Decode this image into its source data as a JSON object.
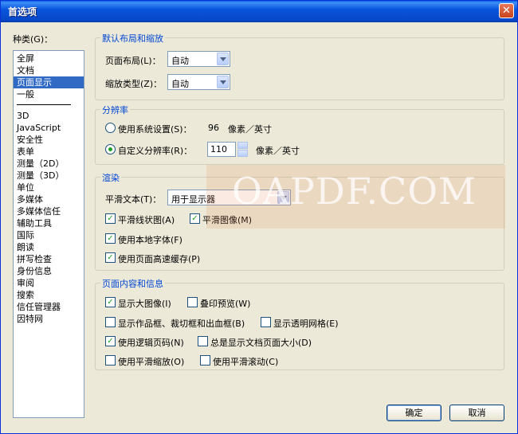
{
  "window": {
    "title": "首选项"
  },
  "category": {
    "label": "种类(G)：",
    "items_top": [
      "全屏",
      "文档",
      "页面显示",
      "一般"
    ],
    "items_bottom": [
      "3D",
      "JavaScript",
      "安全性",
      "表单",
      "测量（2D）",
      "测量（3D）",
      "单位",
      "多媒体",
      "多媒体信任",
      "辅助工具",
      "国际",
      "朗读",
      "拼写检查",
      "身份信息",
      "审阅",
      "搜索",
      "信任管理器",
      "因特网"
    ],
    "selected": "页面显示"
  },
  "layout_group": {
    "title": "默认布局和缩放",
    "page_layout_label": "页面布局(L)：",
    "page_layout_value": "自动",
    "zoom_type_label": "缩放类型(Z)：",
    "zoom_type_value": "自动"
  },
  "resolution_group": {
    "title": "分辨率",
    "system_label": "使用系统设置(S)：",
    "system_value": "96",
    "system_unit": "像素／英寸",
    "custom_label": "自定义分辨率(R)：",
    "custom_value": "110",
    "custom_unit": "像素／英寸",
    "selected": "custom"
  },
  "render_group": {
    "title": "渲染",
    "smooth_text_label": "平滑文本(T)：",
    "smooth_text_value": "用于显示器",
    "smooth_line_art": {
      "label": "平滑线状图(A)",
      "checked": true
    },
    "smooth_images": {
      "label": "平滑图像(M)",
      "checked": true
    },
    "local_fonts": {
      "label": "使用本地字体(F)",
      "checked": true
    },
    "page_cache": {
      "label": "使用页面高速缓存(P)",
      "checked": true
    }
  },
  "content_group": {
    "title": "页面内容和信息",
    "show_large_images": {
      "label": "显示大图像(I)",
      "checked": true
    },
    "overprint_preview": {
      "label": "叠印预览(W)",
      "checked": false
    },
    "show_art_boxes": {
      "label": "显示作品框、裁切框和出血框(B)",
      "checked": false
    },
    "show_transparency_grid": {
      "label": "显示透明网格(E)",
      "checked": false
    },
    "logical_page_numbers": {
      "label": "使用逻辑页码(N)",
      "checked": true
    },
    "always_show_page_size": {
      "label": "总是显示文档页面大小(D)",
      "checked": false
    },
    "smooth_zoom": {
      "label": "使用平滑缩放(O)",
      "checked": false
    },
    "smooth_scroll": {
      "label": "使用平滑滚动(C)",
      "checked": false
    }
  },
  "buttons": {
    "ok": "确定",
    "cancel": "取消"
  },
  "watermark": "OAPDF.COM",
  "colors": {
    "title_bar": "#0855dd",
    "group_title": "#0046d5",
    "selection": "#316ac5",
    "check": "#21a121",
    "dialog_bg": "#ece9d8"
  }
}
